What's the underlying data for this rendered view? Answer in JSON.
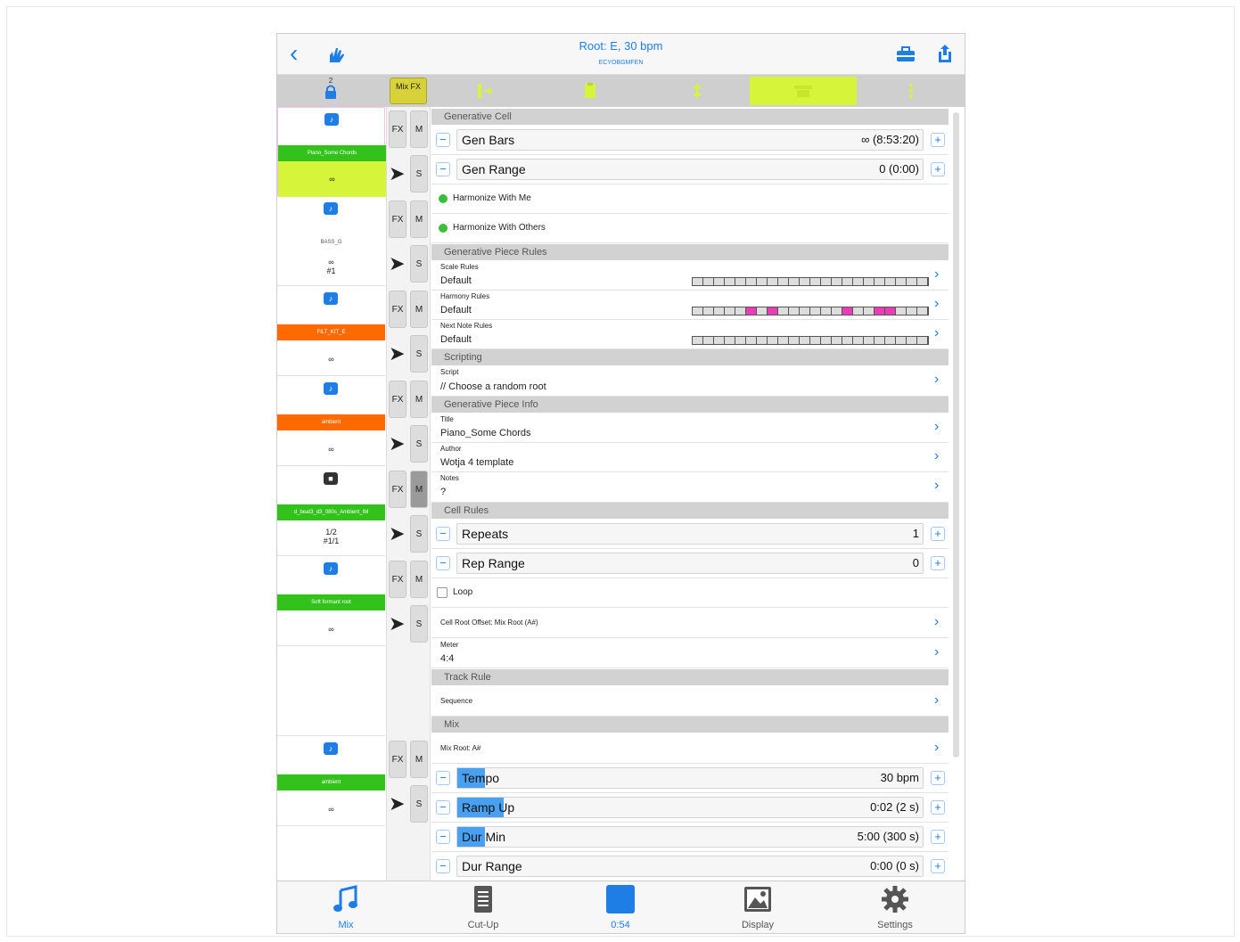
{
  "header": {
    "title": "Root: E, 30 bpm",
    "subtitle": "ECYOBGMFEN"
  },
  "toolbar": {
    "lock_count": "2",
    "mix_fx": "Mix FX"
  },
  "tracks": [
    {
      "label": "Piano_Some Chords",
      "label_color": "#33c11b",
      "value": "∞",
      "highlight": true
    },
    {
      "label": "BASS_G",
      "label_color": "",
      "value": "∞\n#1",
      "highlight": false
    },
    {
      "label": "FILT_KIT_E",
      "label_color": "#ff6a00",
      "value": "∞",
      "highlight": false
    },
    {
      "label": "ambient",
      "label_color": "#ff6a00",
      "value": "∞",
      "highlight": false
    },
    {
      "label": "d_beat3_d3_080s_Ambient_IM",
      "label_color": "#33c11b",
      "value": "1/2\n#1/1",
      "highlight": false
    },
    {
      "label": "Soft formant root",
      "label_color": "#33c11b",
      "value": "∞",
      "highlight": false
    },
    {
      "label": "ambient",
      "label_color": "#33c11b",
      "value": "∞",
      "highlight": false
    }
  ],
  "buttons": {
    "fx": "FX",
    "m": "M",
    "s": "S"
  },
  "sections": {
    "generative_cell": "Generative Cell",
    "piece_rules": "Generative Piece Rules",
    "scripting": "Scripting",
    "piece_info": "Generative Piece Info",
    "cell_rules": "Cell Rules",
    "track_rule": "Track Rule",
    "mix": "Mix"
  },
  "gen_bars": {
    "label": "Gen Bars",
    "value": "∞ (8:53:20)"
  },
  "gen_range": {
    "label": "Gen Range",
    "value": "0 (0:00)"
  },
  "harmonize_me": "Harmonize With Me",
  "harmonize_others": "Harmonize With Others",
  "scale_rules": {
    "label": "Scale Rules",
    "value": "Default"
  },
  "harmony_rules": {
    "label": "Harmony Rules",
    "value": "Default"
  },
  "next_note_rules": {
    "label": "Next Note Rules",
    "value": "Default"
  },
  "script": {
    "label": "Script",
    "value": "// Choose a random root"
  },
  "title_field": {
    "label": "Title",
    "value": "Piano_Some Chords"
  },
  "author_field": {
    "label": "Author",
    "value": "Wotja 4 template"
  },
  "notes_field": {
    "label": "Notes",
    "value": "?"
  },
  "repeats": {
    "label": "Repeats",
    "value": "1"
  },
  "rep_range": {
    "label": "Rep Range",
    "value": "0"
  },
  "loop": "Loop",
  "cell_root_offset": "Cell Root Offset: Mix Root (A#)",
  "meter": {
    "label": "Meter",
    "value": "4:4"
  },
  "sequence": "Sequence",
  "mix_root": "Mix Root: A#",
  "tempo": {
    "label": "Tempo",
    "value": "30 bpm",
    "level": 0.06
  },
  "ramp_up": {
    "label": "Ramp Up",
    "value": "0:02 (2 s)",
    "level": 0.1
  },
  "dur_min": {
    "label": "Dur Min",
    "value": "5:00 (300 s)",
    "level": 0.04
  },
  "dur_range": {
    "label": "Dur Range",
    "value": "0:00 (0 s)",
    "level": 0
  },
  "tabs": [
    {
      "label": "Mix",
      "icon": "music-note-icon"
    },
    {
      "label": "Cut-Up",
      "icon": "document-icon"
    },
    {
      "label": "0:54",
      "icon": "stop-icon"
    },
    {
      "label": "Display",
      "icon": "image-icon"
    },
    {
      "label": "Settings",
      "icon": "gear-icon"
    }
  ],
  "colors": {
    "accent": "#1f7de6",
    "highlight": "#d6f53a",
    "green": "#33c11b",
    "orange": "#ff6a00",
    "magenta": "#ea3db5"
  }
}
